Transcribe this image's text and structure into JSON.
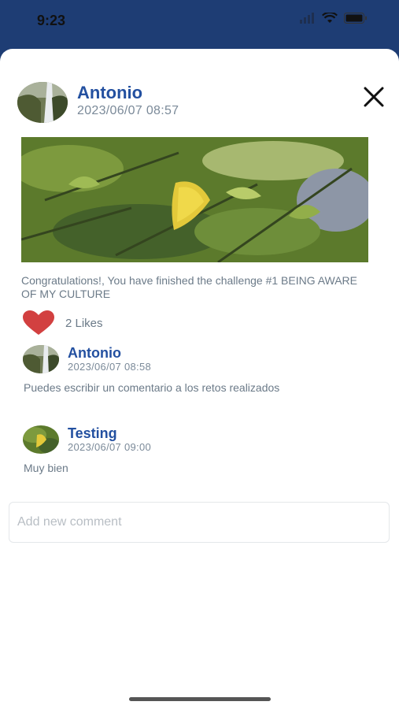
{
  "status": {
    "time": "9:23",
    "icons": [
      "signal-icon",
      "wifi-icon",
      "battery-icon"
    ]
  },
  "post": {
    "author": "Antonio",
    "date": "2023/06/07 08:57",
    "caption": "Congratulations!, You have finished the challenge #1 BEING AWARE OF MY CULTURE",
    "likes": "2 Likes"
  },
  "comments": [
    {
      "author": "Antonio",
      "date": "2023/06/07 08:58",
      "text": "Puedes escribir un comentario a los retos realizados"
    },
    {
      "author": "Testing",
      "date": "2023/06/07 09:00",
      "text": "Muy bien"
    }
  ],
  "input": {
    "placeholder": "Add new comment"
  },
  "colors": {
    "header": "#1e3d74",
    "accent": "#2350a0",
    "like": "#d24040"
  }
}
